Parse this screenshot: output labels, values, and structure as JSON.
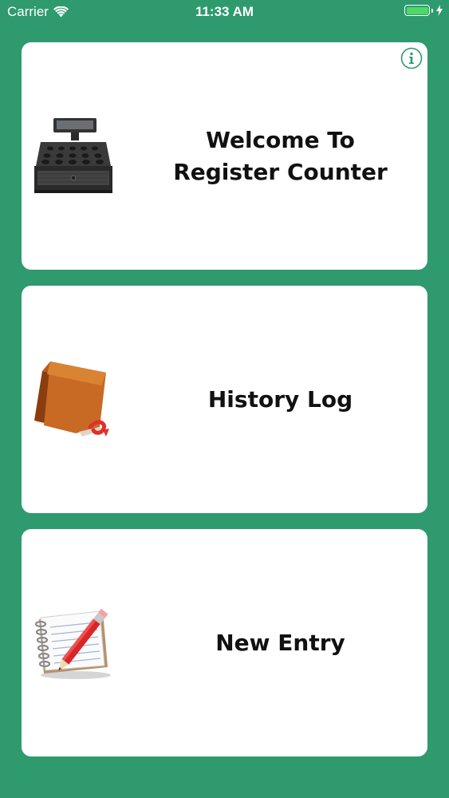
{
  "status_bar": {
    "carrier": "Carrier",
    "time": "11:33 AM",
    "battery_level_percent": 100,
    "battery_color": "#4cd964"
  },
  "theme": {
    "background": "#2e9a6e",
    "card_background": "#ffffff",
    "info_color": "#2e9a6e"
  },
  "cards": [
    {
      "title_line1": "Welcome To",
      "title_line2": "Register Counter",
      "icon": "cash-register-icon",
      "has_info_button": true,
      "info_icon": "info-icon"
    },
    {
      "title": "History Log",
      "icon": "book-icon"
    },
    {
      "title": "New Entry",
      "icon": "notepad-pencil-icon"
    }
  ]
}
